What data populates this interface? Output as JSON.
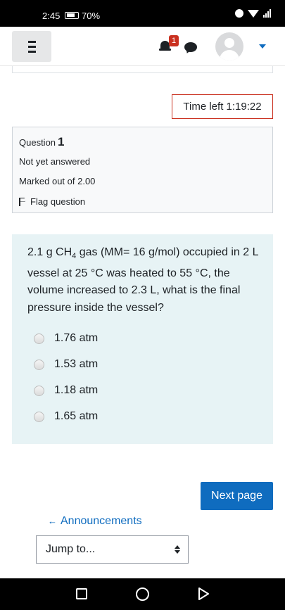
{
  "status_bar": {
    "time": "2:45",
    "battery": "70%"
  },
  "navbar": {
    "notification_count": "1"
  },
  "quiz": {
    "time_left": "Time left 1:19:22",
    "question": {
      "label": "Question",
      "number": "1",
      "state": "Not yet answered",
      "marked_out_of": "Marked out of 2.00",
      "flag_label": "Flag question",
      "text_part1": "2.1 g CH",
      "text_sub": "4",
      "text_part2": " gas (MM= 16 g/mol) occupied in 2 L vessel at 25 °C was heated to 55 °C, the volume increased to 2.3 L, what is the final pressure inside the vessel?",
      "answers": [
        {
          "label": "1.76 atm",
          "selected": false
        },
        {
          "label": "1.53 atm",
          "selected": false
        },
        {
          "label": "1.18 atm",
          "selected": false
        },
        {
          "label": "1.65 atm",
          "selected": false
        }
      ]
    },
    "next_button": "Next page",
    "prev_link": "Announcements",
    "jump_select": "Jump to..."
  },
  "colors": {
    "primary": "#0f6cbf",
    "timer_border": "#ca3120",
    "question_bg": "#e7f3f5",
    "info_bg": "#f8f9fa"
  },
  "icons": [
    "menu-icon",
    "bell-icon",
    "chat-icon",
    "avatar-icon",
    "chevron-down-icon",
    "flag-icon",
    "arrow-left-icon",
    "select-arrows-icon",
    "recent-apps-icon",
    "home-icon",
    "back-icon"
  ]
}
